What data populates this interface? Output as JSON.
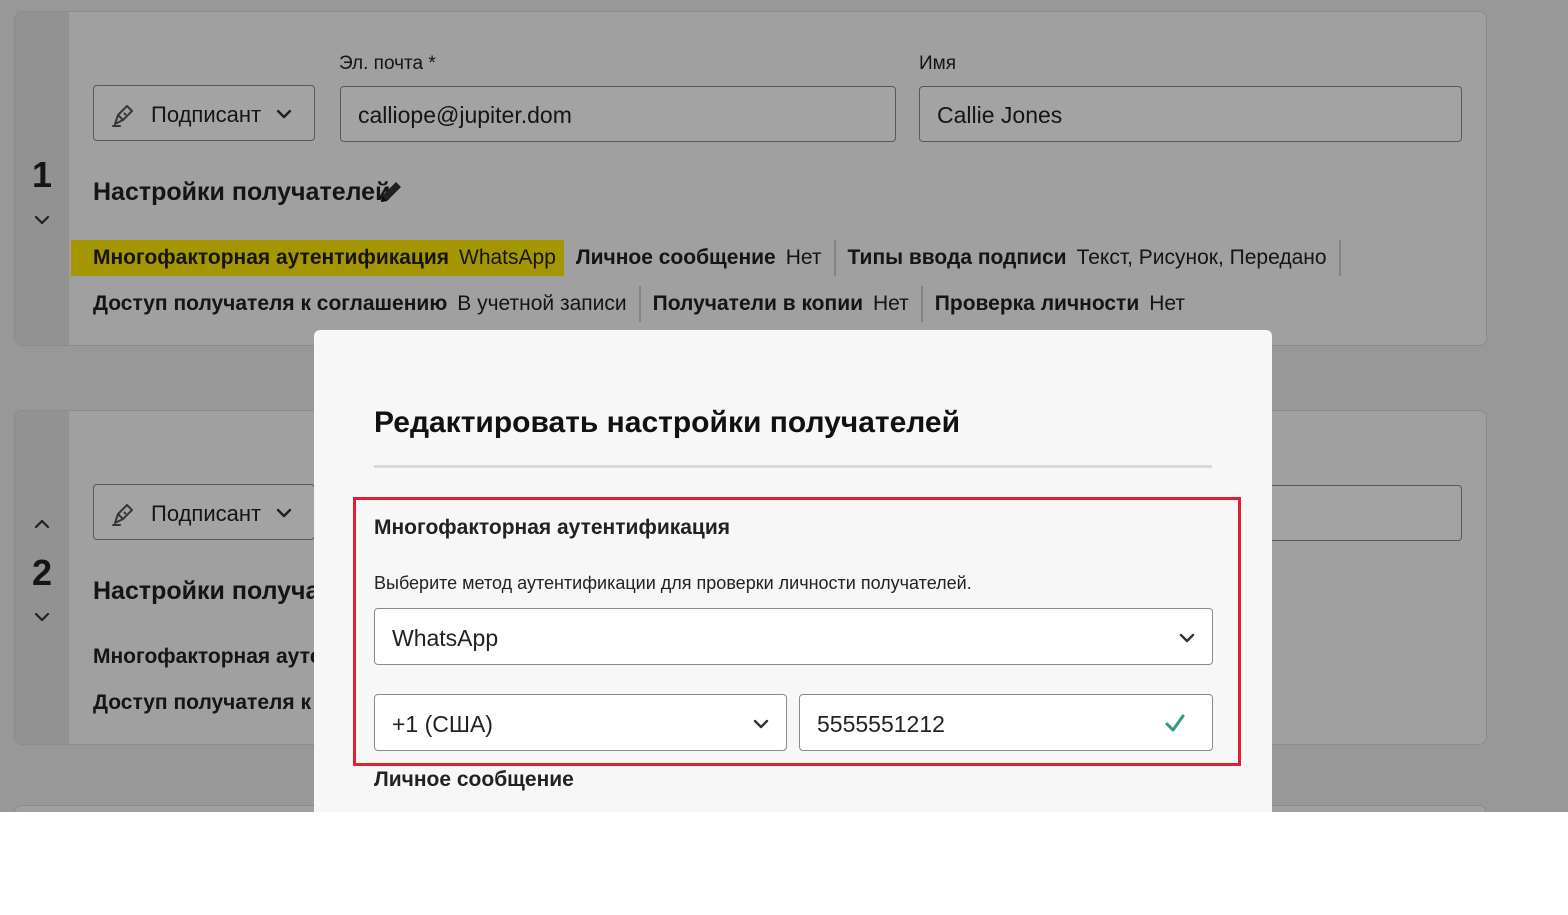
{
  "recipients": [
    {
      "number": "1",
      "role": "Подписант",
      "email_label": "Эл. почта",
      "email_required_mark": "*",
      "email_value": "calliope@jupiter.dom",
      "name_label": "Имя",
      "name_value": "Callie Jones",
      "settings_title": "Настройки получателей",
      "settings_row1": [
        {
          "label": "Многофакторная аутентификация",
          "value": "WhatsApp",
          "highlighted": true
        },
        {
          "label": "Личное сообщение",
          "value": "Нет"
        },
        {
          "label": "Типы ввода подписи",
          "value": "Текст, Рисунок, Передано"
        }
      ],
      "settings_row2": [
        {
          "label": "Доступ получателя к соглашению",
          "value": "В учетной записи"
        },
        {
          "label": "Получатели в копии",
          "value": "Нет"
        },
        {
          "label": "Проверка личности",
          "value": "Нет"
        }
      ]
    },
    {
      "number": "2",
      "role": "Подписант",
      "settings_title_partial": "Настройки получател",
      "row1_partial": "Многофакторная аутент",
      "row2_partial": "Доступ получателя к со"
    }
  ],
  "modal": {
    "title": "Редактировать настройки получателей",
    "mfa_title": "Многофакторная аутентификация",
    "mfa_description": "Выберите метод аутентификации для проверки личности получателей.",
    "method_selected": "WhatsApp",
    "country_code_selected": "+1 (США)",
    "phone_value": "5555551212",
    "personal_message_title": "Личное сообщение"
  },
  "colors": {
    "highlight": "#ffeb00",
    "annotation_box": "#e0202e",
    "valid_check": "#2d9d78"
  }
}
